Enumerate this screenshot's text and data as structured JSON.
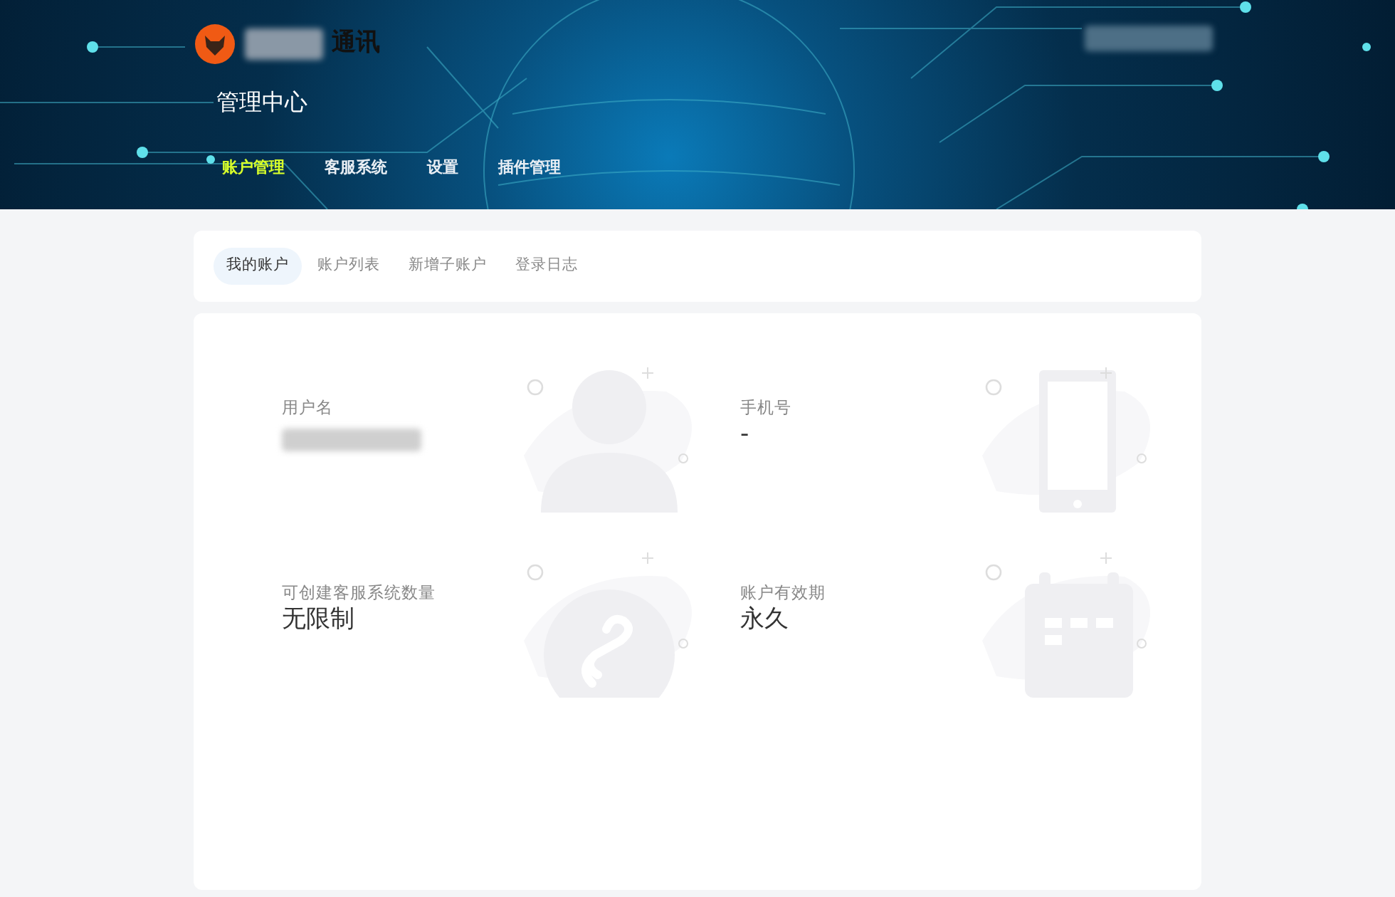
{
  "header": {
    "brand": "通讯",
    "title": "管理中心",
    "nav": [
      {
        "label": "账户管理",
        "selected": true
      },
      {
        "label": "客服系统",
        "selected": false
      },
      {
        "label": "设置",
        "selected": false
      },
      {
        "label": "插件管理",
        "selected": false
      }
    ]
  },
  "tabs": [
    {
      "label": "我的账户",
      "selected": true
    },
    {
      "label": "账户列表",
      "selected": false
    },
    {
      "label": "新增子账户",
      "selected": false
    },
    {
      "label": "登录日志",
      "selected": false
    }
  ],
  "info": [
    {
      "kind": "user",
      "label": "用户名"
    },
    {
      "kind": "phone",
      "label": "手机号",
      "value": "-"
    },
    {
      "kind": "link",
      "label": "可创建客服系统数量",
      "value": "无限制"
    },
    {
      "kind": "calendar",
      "label": "账户有效期",
      "value": "永久"
    }
  ]
}
